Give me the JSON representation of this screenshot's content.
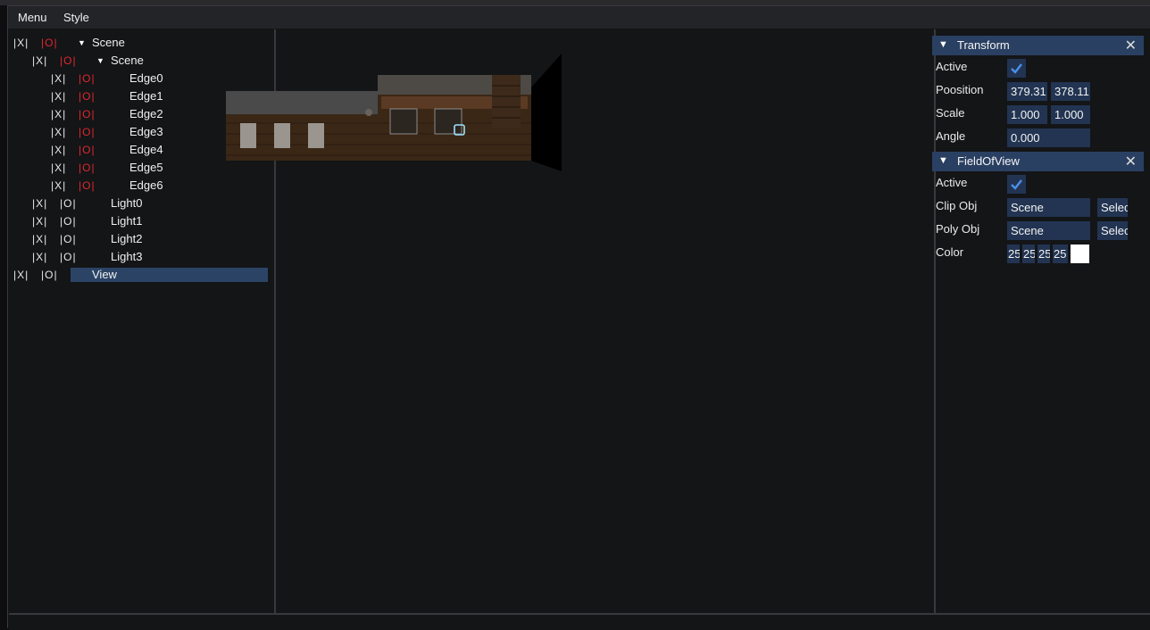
{
  "menubar": {
    "menu": "Menu",
    "style": "Style"
  },
  "tree": {
    "toggle_x": "|X|",
    "toggle_o": "|O|",
    "rows": [
      {
        "label": "Scene",
        "expandable": true,
        "o_red": true
      },
      {
        "label": "Scene",
        "expandable": true,
        "o_red": true
      },
      {
        "label": "Edge0",
        "expandable": false,
        "o_red": true
      },
      {
        "label": "Edge1",
        "expandable": false,
        "o_red": true
      },
      {
        "label": "Edge2",
        "expandable": false,
        "o_red": true
      },
      {
        "label": "Edge3",
        "expandable": false,
        "o_red": true
      },
      {
        "label": "Edge4",
        "expandable": false,
        "o_red": true
      },
      {
        "label": "Edge5",
        "expandable": false,
        "o_red": true
      },
      {
        "label": "Edge6",
        "expandable": false,
        "o_red": true
      },
      {
        "label": "Light0",
        "expandable": false,
        "o_red": false
      },
      {
        "label": "Light1",
        "expandable": false,
        "o_red": false
      },
      {
        "label": "Light2",
        "expandable": false,
        "o_red": false
      },
      {
        "label": "Light3",
        "expandable": false,
        "o_red": false
      },
      {
        "label": "View",
        "expandable": false,
        "o_red": false,
        "selected": true
      }
    ]
  },
  "inspector": {
    "transform": {
      "title": "Transform",
      "active_label": "Active",
      "position_label": "Poosition",
      "position_x": "379.31",
      "position_y": "378.11",
      "scale_label": "Scale",
      "scale_x": "1.000",
      "scale_y": "1.000",
      "angle_label": "Angle",
      "angle": "0.000"
    },
    "fov": {
      "title": "FieldOfView",
      "active_label": "Active",
      "clip_label": "Clip Obj",
      "clip_value": "Scene",
      "clip_button": "Selec",
      "poly_label": "Poly Obj",
      "poly_value": "Scene",
      "poly_button": "Selec",
      "color_label": "Color",
      "color_r": "25",
      "color_g": "25",
      "color_b": "25",
      "color_a": "25"
    }
  },
  "colors": {
    "accent": "#2a4062",
    "field": "#223452",
    "check": "#4a90e8",
    "red": "#e0282e",
    "swatch": "#ffffff"
  }
}
